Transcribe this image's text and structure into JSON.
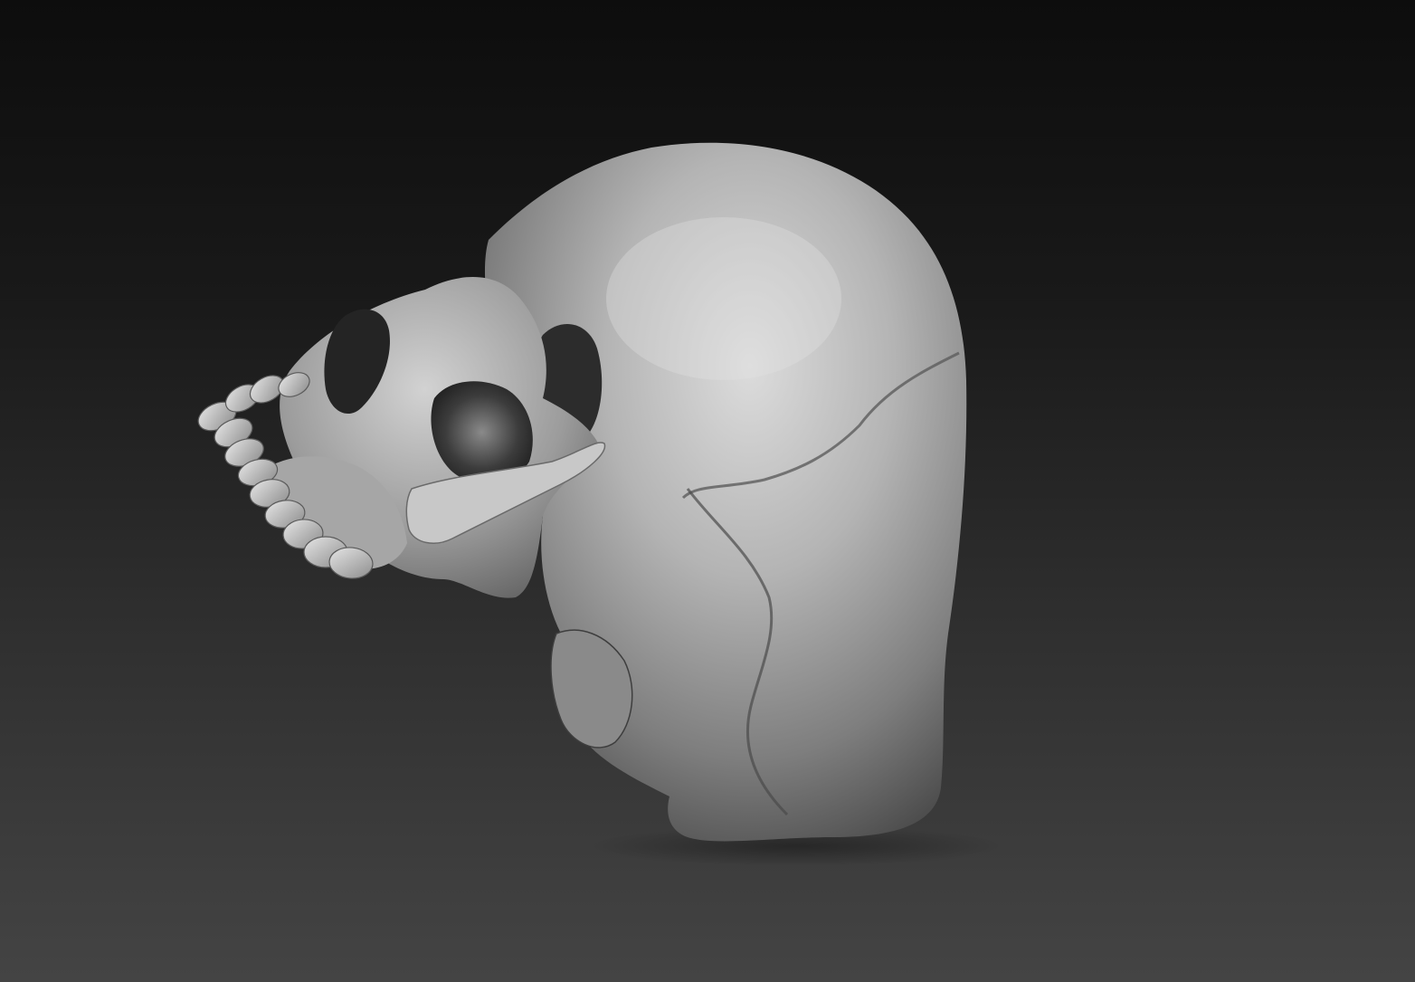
{
  "viewport": {
    "background_top": "#0d0d0d",
    "background_bottom": "#444444"
  },
  "model": {
    "subject_icon": "skull-sculpt-icon",
    "material_color": "#9a9a9a",
    "highlight_color": "#d8d8d8",
    "shadow_color": "#2a2a2a"
  }
}
